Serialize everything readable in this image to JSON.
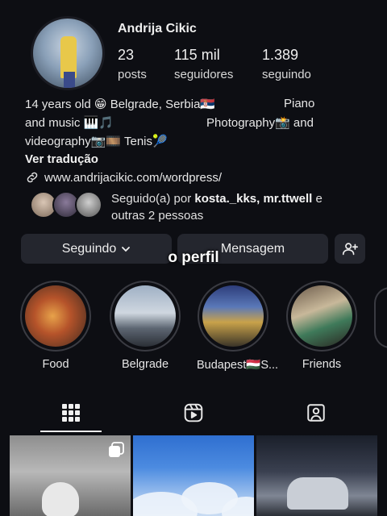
{
  "profile": {
    "username": "Andrija Cikic",
    "stats": {
      "posts_count": "23",
      "posts_label": "posts",
      "followers_count": "115 mil",
      "followers_label": "seguidores",
      "following_count": "1.389",
      "following_label": "seguindo"
    },
    "bio": {
      "line1a": "14 years old 😁 Belgrade, Serbia🇷🇸",
      "line1b": "Piano",
      "line2a": "and music 🎹🎵",
      "line2b": "Photography📸 and",
      "line3": "videography📷🎞️ Tenis🎾",
      "translate": "Ver tradução",
      "link": "www.andrijacikic.com/wordpress/"
    },
    "followed_by": {
      "prefix": "Seguido(a) por ",
      "names": "kosta._kks, mr.ttwell",
      "suffix": " e",
      "line2": "outras 2 pessoas"
    }
  },
  "actions": {
    "following_label": "Seguindo",
    "message_label": "Mensagem"
  },
  "overlay_caption": "o perfil",
  "highlights": [
    {
      "label": "Food"
    },
    {
      "label": "Belgrade"
    },
    {
      "label": "Budapest🇭🇺S..."
    },
    {
      "label": "Friends"
    }
  ],
  "icons": {
    "link": "link-icon",
    "chevron": "chevron-down-icon",
    "add_user": "add-user-icon",
    "grid": "grid-icon",
    "reels": "reels-icon",
    "tagged": "tagged-icon",
    "multi": "multiple-posts-icon"
  },
  "colors": {
    "background": "#0d0e13",
    "button": "#24262e",
    "text": "#f1f1f1"
  }
}
